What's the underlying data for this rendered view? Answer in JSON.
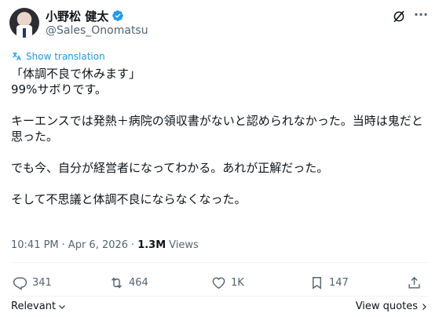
{
  "author": {
    "name": "小野松 健太",
    "handle": "@Sales_Onomatsu",
    "verified": true
  },
  "translate_link": "Show translation",
  "post": {
    "lines": [
      "「体調不良で休みます」",
      "99%サボりです。",
      "",
      "キーエンスでは発熱＋病院の領収書がないと認められなかった。当時は鬼だと思った。",
      "",
      "でも今、自分が経営者になってわかる。あれが正解だった。",
      "",
      "そして不思議と体調不良にならなくなった。"
    ]
  },
  "meta": {
    "time": "10:41 PM",
    "separator": "·",
    "date": "Apr 6, 2026",
    "views_separator": "·",
    "views_count": "1.3M",
    "views_label": "Views"
  },
  "actions": {
    "reply_count": "341",
    "retweet_count": "464",
    "like_count": "1K",
    "bookmark_count": "147"
  },
  "footer": {
    "sort_label": "Relevant",
    "view_quotes": "View quotes"
  },
  "colors": {
    "accent": "#1d9bf0",
    "text": "#0f1419",
    "muted": "#536471",
    "divider": "#eff3f4"
  },
  "icons": [
    "verified-badge-icon",
    "grok-icon",
    "more-icon",
    "translate-icon",
    "reply-icon",
    "retweet-icon",
    "like-icon",
    "bookmark-icon",
    "share-icon",
    "chevron-down-icon",
    "chevron-right-icon"
  ]
}
